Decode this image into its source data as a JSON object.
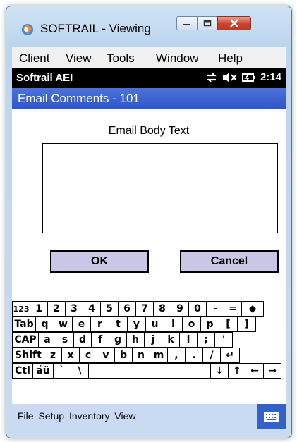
{
  "window": {
    "title": "SOFTRAIL - Viewing"
  },
  "menu": [
    "Client",
    "View",
    "Tools",
    "Window",
    "Help"
  ],
  "status": {
    "carrier": "Softrail AEI",
    "time": "2:14"
  },
  "form": {
    "title": "Email Comments - 101",
    "email_label": "Email Body Text",
    "email_value": "",
    "ok_label": "OK",
    "cancel_label": "Cancel"
  },
  "keyboard": {
    "rows": [
      [
        "123",
        "1",
        "2",
        "3",
        "4",
        "5",
        "6",
        "7",
        "8",
        "9",
        "0",
        "-",
        "=",
        "◆"
      ],
      [
        "Tab",
        "q",
        "w",
        "e",
        "r",
        "t",
        "y",
        "u",
        "i",
        "o",
        "p",
        "[",
        "]"
      ],
      [
        "CAP",
        "a",
        "s",
        "d",
        "f",
        "g",
        "h",
        "j",
        "k",
        "l",
        ";",
        "'"
      ],
      [
        "Shift",
        "z",
        "x",
        "c",
        "v",
        "b",
        "n",
        "m",
        ",",
        ".",
        "/",
        "↵"
      ],
      [
        "Ctl",
        "áü",
        "`",
        "\\",
        "",
        "↓",
        "↑",
        "←",
        "→"
      ]
    ]
  },
  "command_bar": {
    "items": [
      "File",
      "Setup",
      "Inventory",
      "View"
    ],
    "keyboard_icon": "keyboard-icon"
  },
  "colors": {
    "title_blue": "#2f55c8",
    "button_fill": "#c8c8e6",
    "command_bar": "#c9daf2"
  }
}
